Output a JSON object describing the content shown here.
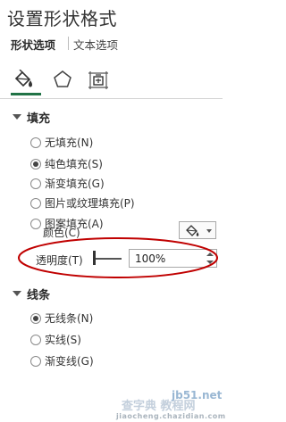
{
  "pane": {
    "title": "设置形状格式"
  },
  "tabs": [
    {
      "label": "形状选项",
      "active": true
    },
    {
      "label": "文本选项",
      "active": false
    }
  ],
  "icon_tabs": [
    {
      "icon": "paint-bucket-icon",
      "active": true
    },
    {
      "icon": "pentagon-icon",
      "active": false
    },
    {
      "icon": "size-properties-icon",
      "active": false
    }
  ],
  "fill": {
    "header": "填充",
    "options": [
      {
        "label": "无填充(N)",
        "checked": false
      },
      {
        "label": "纯色填充(S)",
        "checked": true
      },
      {
        "label": "渐变填充(G)",
        "checked": false
      },
      {
        "label": "图片或纹理填充(P)",
        "checked": false
      },
      {
        "label": "图案填充(A)",
        "checked": false
      }
    ],
    "color_label": "颜色(C)",
    "transparency_label": "透明度(T)",
    "transparency_value": "100%"
  },
  "line": {
    "header": "线条",
    "options": [
      {
        "label": "无线条(N)",
        "checked": true
      },
      {
        "label": "实线(S)",
        "checked": false
      },
      {
        "label": "渐变线(G)",
        "checked": false
      }
    ]
  },
  "colors": {
    "accent": "#217346",
    "highlight": "#c00000"
  },
  "watermark": {
    "main": "查字典 教程网",
    "site": "jb51.net",
    "sub": "jiaocheng.chazidian.com"
  }
}
